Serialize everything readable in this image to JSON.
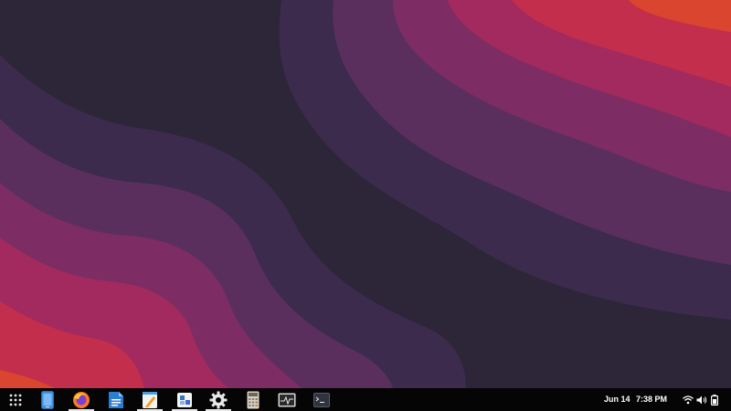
{
  "colors": {
    "taskbar_bg": "#050505",
    "wallpaper_bands": [
      "#2c2638",
      "#3c2b4d",
      "#5a2f5e",
      "#7d2d63",
      "#a22a5e",
      "#c42e4d",
      "#d9452e"
    ]
  },
  "dock": {
    "items": [
      {
        "name": "app-grid",
        "icon": "app-grid-icon",
        "running": false
      },
      {
        "name": "phone",
        "icon": "phone-icon",
        "running": false
      },
      {
        "name": "firefox",
        "icon": "firefox-icon",
        "running": true
      },
      {
        "name": "writer",
        "icon": "document-writer-icon",
        "running": false
      },
      {
        "name": "text-editor",
        "icon": "text-editor-icon",
        "running": true
      },
      {
        "name": "software",
        "icon": "software-store-icon",
        "running": true
      },
      {
        "name": "settings",
        "icon": "gear-icon",
        "running": true
      },
      {
        "name": "calculator",
        "icon": "calculator-icon",
        "running": false
      },
      {
        "name": "system-monitor",
        "icon": "system-monitor-icon",
        "running": false
      },
      {
        "name": "terminal",
        "icon": "terminal-icon",
        "running": false
      }
    ]
  },
  "clock": {
    "date": "Jun 14",
    "time": "7:38 PM"
  },
  "tray": {
    "icons": [
      "wifi-icon",
      "volume-icon",
      "battery-icon"
    ]
  }
}
